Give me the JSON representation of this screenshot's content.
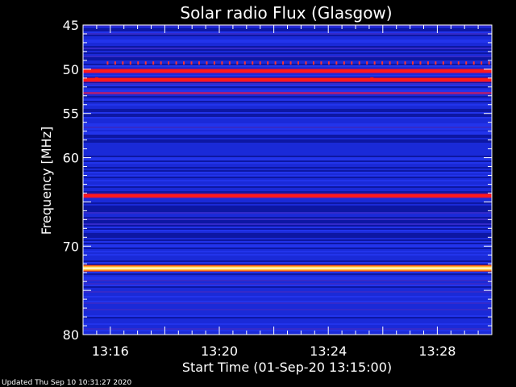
{
  "chart_data": {
    "type": "heatmap",
    "title": "Solar radio Flux (Glasgow)",
    "xlabel": "Start Time (01-Sep-20 13:15:00)",
    "ylabel": "Frequency [MHz]",
    "x_ticks": [
      "13:16",
      "13:20",
      "13:24",
      "13:28"
    ],
    "x_tick_minutes": [
      1,
      5,
      9,
      13
    ],
    "xlim_minutes": [
      0,
      15
    ],
    "y_ticks": [
      45,
      50,
      55,
      60,
      70,
      80
    ],
    "ylim": [
      45,
      80
    ],
    "footer": "Updated Thu Sep 10 10:31:27 2020",
    "bands": [
      {
        "freq": 50.2,
        "intensity": "high"
      },
      {
        "freq": 51.2,
        "intensity": "high"
      },
      {
        "freq": 52.7,
        "intensity": "medium"
      },
      {
        "freq": 64.3,
        "intensity": "high"
      },
      {
        "freq": 72.5,
        "intensity": "max"
      }
    ],
    "colors": {
      "background": "#1a2ad8",
      "low": "#0f1aa8",
      "medium": "#6a2ad0",
      "high": "#ff1a1a",
      "max": "#ffffff",
      "frame": "#ffffff"
    }
  }
}
